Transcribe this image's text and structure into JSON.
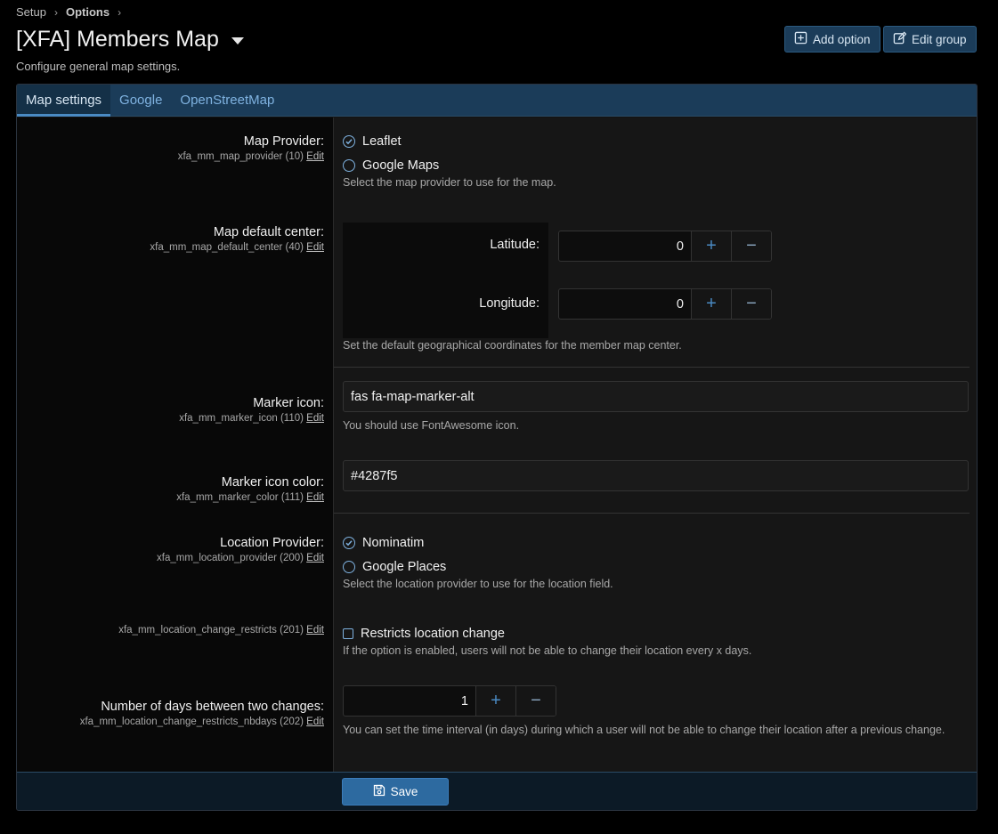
{
  "breadcrumb": {
    "item1": "Setup",
    "item2": "Options"
  },
  "header": {
    "title": "[XFA] Members Map",
    "description": "Configure general map settings.",
    "add_option": "Add option",
    "edit_group": "Edit group"
  },
  "tabs": [
    "Map settings",
    "Google",
    "OpenStreetMap"
  ],
  "options": {
    "map_provider": {
      "title": "Map Provider:",
      "key": "xfa_mm_map_provider (10)",
      "edit": "Edit",
      "choices": [
        "Leaflet",
        "Google Maps"
      ],
      "selected": "Leaflet",
      "hint": "Select the map provider to use for the map."
    },
    "default_center": {
      "title": "Map default center:",
      "key": "xfa_mm_map_default_center (40)",
      "edit": "Edit",
      "latitude_label": "Latitude:",
      "latitude_value": "0",
      "longitude_label": "Longitude:",
      "longitude_value": "0",
      "hint": "Set the default geographical coordinates for the member map center."
    },
    "marker_icon": {
      "title": "Marker icon:",
      "key": "xfa_mm_marker_icon (110)",
      "edit": "Edit",
      "value": "fas fa-map-marker-alt",
      "hint": "You should use FontAwesome icon."
    },
    "marker_color": {
      "title": "Marker icon color:",
      "key": "xfa_mm_marker_color (111)",
      "edit": "Edit",
      "value": "#4287f5"
    },
    "location_provider": {
      "title": "Location Provider:",
      "key": "xfa_mm_location_provider (200)",
      "edit": "Edit",
      "choices": [
        "Nominatim",
        "Google Places"
      ],
      "selected": "Nominatim",
      "hint": "Select the location provider to use for the location field."
    },
    "change_restricts": {
      "key": "xfa_mm_location_change_restricts (201)",
      "edit": "Edit",
      "checkbox_label": "Restricts location change",
      "checked": false,
      "hint": "If the option is enabled, users will not be able to change their location every x days."
    },
    "nbdays": {
      "title": "Number of days between two changes:",
      "key": "xfa_mm_location_change_restricts_nbdays (202)",
      "edit": "Edit",
      "value": "1",
      "hint": "You can set the time interval (in days) during which a user will not be able to change their location after a previous change."
    }
  },
  "stepper": {
    "plus": "+",
    "minus": "−"
  },
  "footer": {
    "save": "Save"
  },
  "colors": {
    "accent": "#4a8ac3",
    "tab_bar": "#1b3c59",
    "save": "#2d6aa0"
  }
}
